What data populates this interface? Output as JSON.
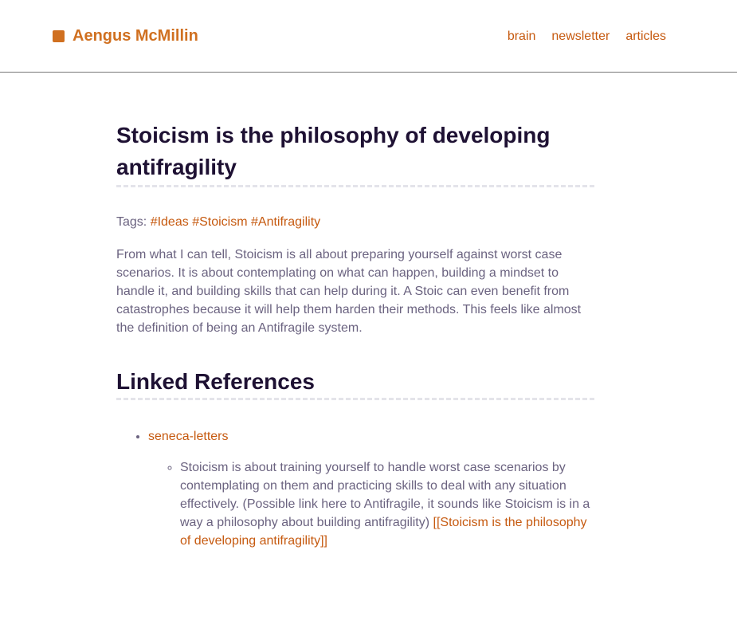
{
  "header": {
    "brand_name": "Aengus McMillin",
    "nav": [
      {
        "label": "brain"
      },
      {
        "label": "newsletter"
      },
      {
        "label": "articles"
      }
    ]
  },
  "article": {
    "title": "Stoicism is the philosophy of developing antifragility",
    "tags_label": "Tags: ",
    "tags": [
      "#Ideas",
      "#Stoicism",
      "#Antifragility"
    ],
    "body": "From what I can tell, Stoicism is all about preparing yourself against worst case scenarios. It is about contemplating on what can happen, building a mindset to handle it, and building skills that can help during it. A Stoic can even benefit from catastrophes because it will help them harden their methods. This feels like almost the definition of being an Antifragile system."
  },
  "linked_references": {
    "heading": "Linked References",
    "items": [
      {
        "link_label": "seneca-letters",
        "excerpt_text": "Stoicism is about training yourself to handle worst case scenarios by contemplating on them and practicing skills to deal with any situation effectively. (Possible link here to Antifragile, it sounds like Stoicism is in a way a philosophy about building antifragility) ",
        "excerpt_link": "[[Stoicism is the philosophy of developing antifragility]]"
      }
    ]
  },
  "colors": {
    "accent": "#d07020",
    "link": "#c65a10",
    "heading": "#1e1133",
    "body_text": "#6b6380"
  }
}
